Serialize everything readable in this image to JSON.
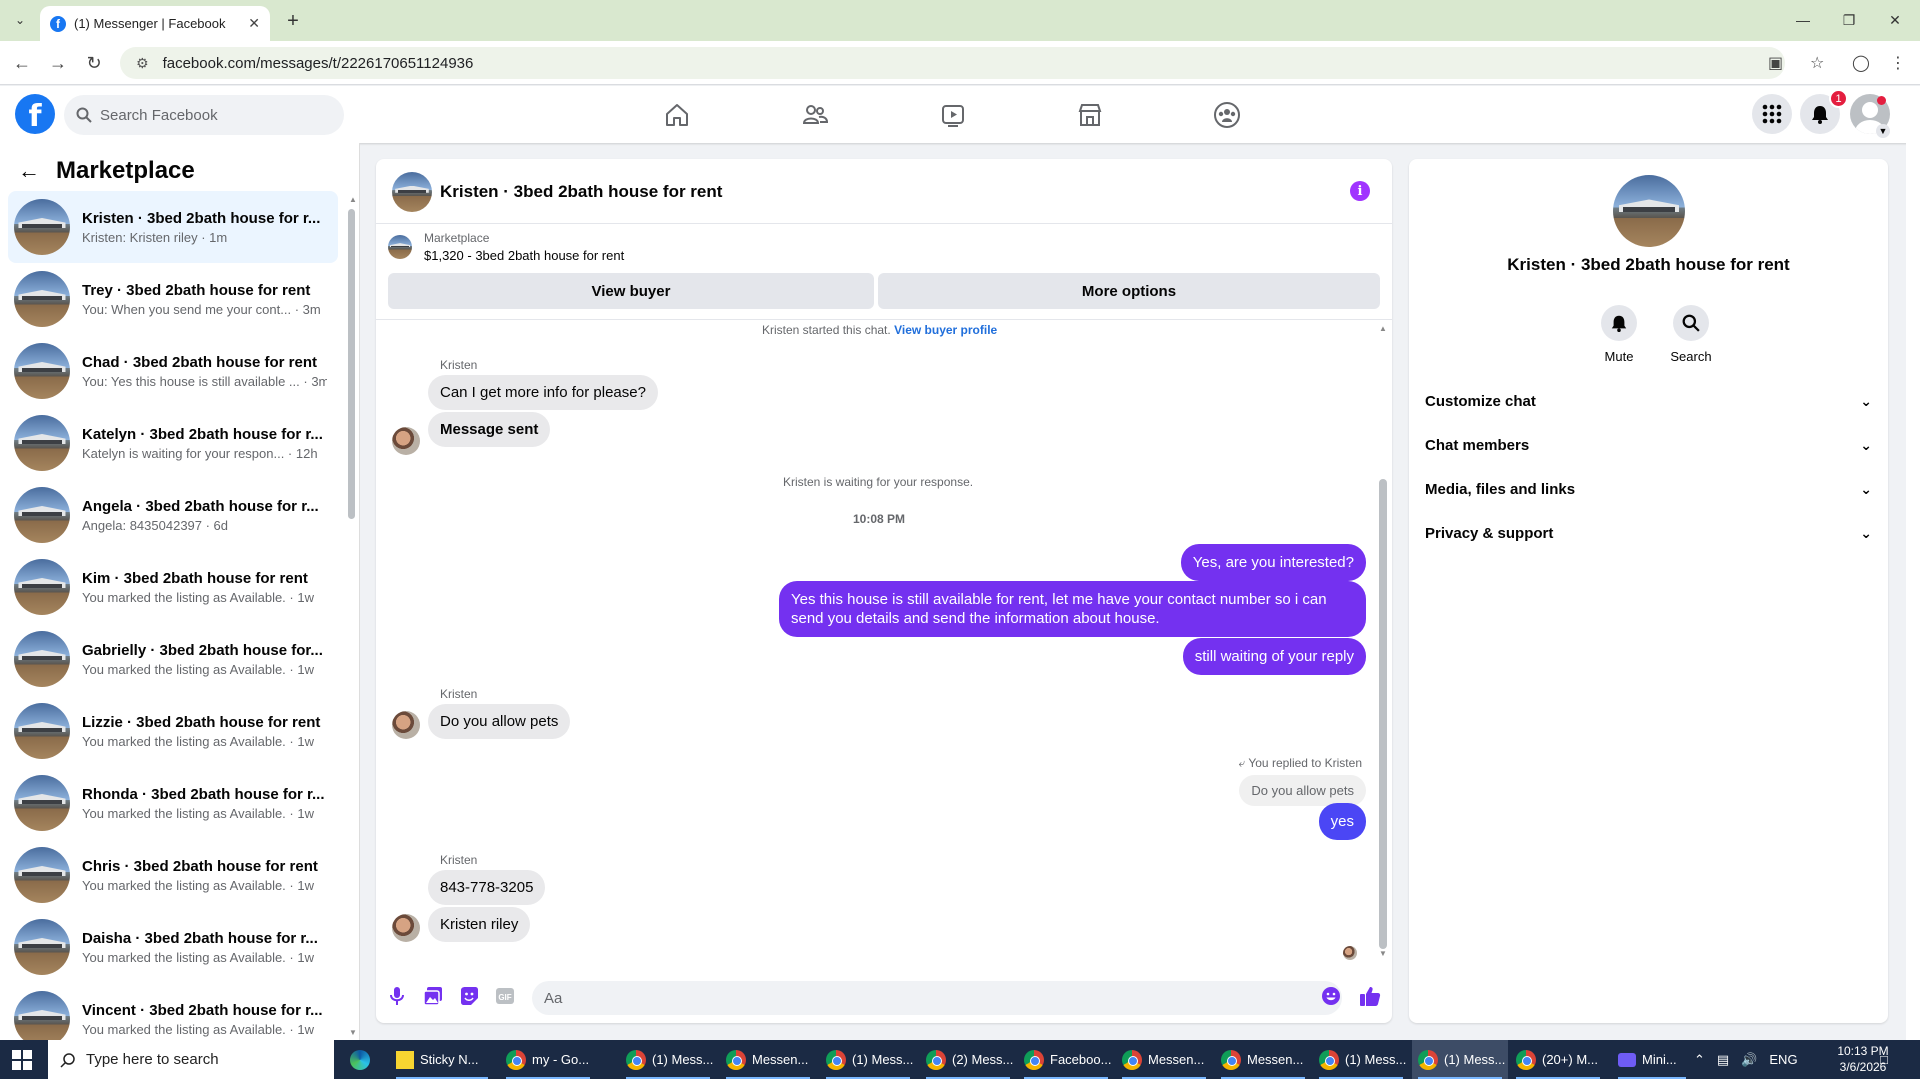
{
  "browser": {
    "tab_title": "(1) Messenger | Facebook",
    "url": "facebook.com/messages/t/2226170651124936"
  },
  "fb": {
    "search_placeholder": "Search Facebook",
    "notification_count": "1",
    "nav_icons": [
      "home-icon",
      "friends-icon",
      "watch-icon",
      "marketplace-icon",
      "groups-icon"
    ]
  },
  "sidebar": {
    "title": "Marketplace",
    "conversations": [
      {
        "name": "Kristen · 3bed 2bath house for r...",
        "preview": "Kristen: Kristen riley · 1m",
        "active": true
      },
      {
        "name": "Trey · 3bed 2bath house for rent",
        "preview": "You: When you send me your cont... · 3m"
      },
      {
        "name": "Chad · 3bed 2bath house for rent",
        "preview": "You: Yes this house is still available ... · 3m"
      },
      {
        "name": "Katelyn · 3bed 2bath house for r...",
        "preview": "Katelyn is waiting for your respon... · 12h"
      },
      {
        "name": "Angela · 3bed 2bath house for r...",
        "preview": "Angela: 8435042397 · 6d"
      },
      {
        "name": "Kim · 3bed 2bath house for rent",
        "preview": "You marked the listing as Available. · 1w"
      },
      {
        "name": "Gabrielly · 3bed 2bath house for...",
        "preview": "You marked the listing as Available. · 1w"
      },
      {
        "name": "Lizzie · 3bed 2bath house for rent",
        "preview": "You marked the listing as Available. · 1w"
      },
      {
        "name": "Rhonda · 3bed 2bath house for r...",
        "preview": "You marked the listing as Available. · 1w"
      },
      {
        "name": "Chris · 3bed 2bath house for rent",
        "preview": "You marked the listing as Available. · 1w"
      },
      {
        "name": "Daisha · 3bed 2bath house for r...",
        "preview": "You marked the listing as Available. · 1w"
      },
      {
        "name": "Vincent · 3bed 2bath house for r...",
        "preview": "You marked the listing as Available. · 1w"
      }
    ]
  },
  "chat": {
    "title": "Kristen · 3bed 2bath house for rent",
    "marketplace_label": "Marketplace",
    "listing": "$1,320 - 3bed 2bath house for rent",
    "view_buyer": "View buyer",
    "more_options": "More options",
    "started_text": "Kristen started this chat.",
    "view_buyer_profile": "View buyer profile",
    "sender_name": "Kristen",
    "msg_more_info": "Can I get more info for please?",
    "msg_sent": "Message sent",
    "waiting": "Kristen is waiting for your response.",
    "time": "10:08 PM",
    "out_1": "Yes, are you interested?",
    "out_2": "Yes this house is still available for rent, let me have your contact number so i can send you details and send the information about house.",
    "out_3": "still waiting of your reply",
    "msg_pets": "Do you allow pets",
    "replied_label": "You replied to Kristen",
    "quoted": "Do you allow pets",
    "out_yes": "yes",
    "msg_phone": "843-778-3205",
    "msg_name": "Kristen riley",
    "composer_placeholder": "Aa"
  },
  "details": {
    "title": "Kristen · 3bed 2bath house for rent",
    "mute": "Mute",
    "search": "Search",
    "sections": [
      "Customize chat",
      "Chat members",
      "Media, files and links",
      "Privacy & support"
    ]
  },
  "taskbar": {
    "search_placeholder": "Type here to search",
    "apps": [
      "Sticky N...",
      "my - Go...",
      "(1) Mess...",
      "Messen...",
      "(1) Mess...",
      "(2) Mess...",
      "Faceboo...",
      "Messen...",
      "Messen...",
      "(1) Mess...",
      "(1) Mess...",
      "(20+) M...",
      "Mini..."
    ],
    "lang": "ENG",
    "time": "10:13 PM",
    "date": "3/6/2026"
  },
  "colors": {
    "fb_blue": "#1877f2",
    "outgoing": "#7431f0",
    "incoming": "#e9e9eb",
    "link": "#216fdb"
  }
}
